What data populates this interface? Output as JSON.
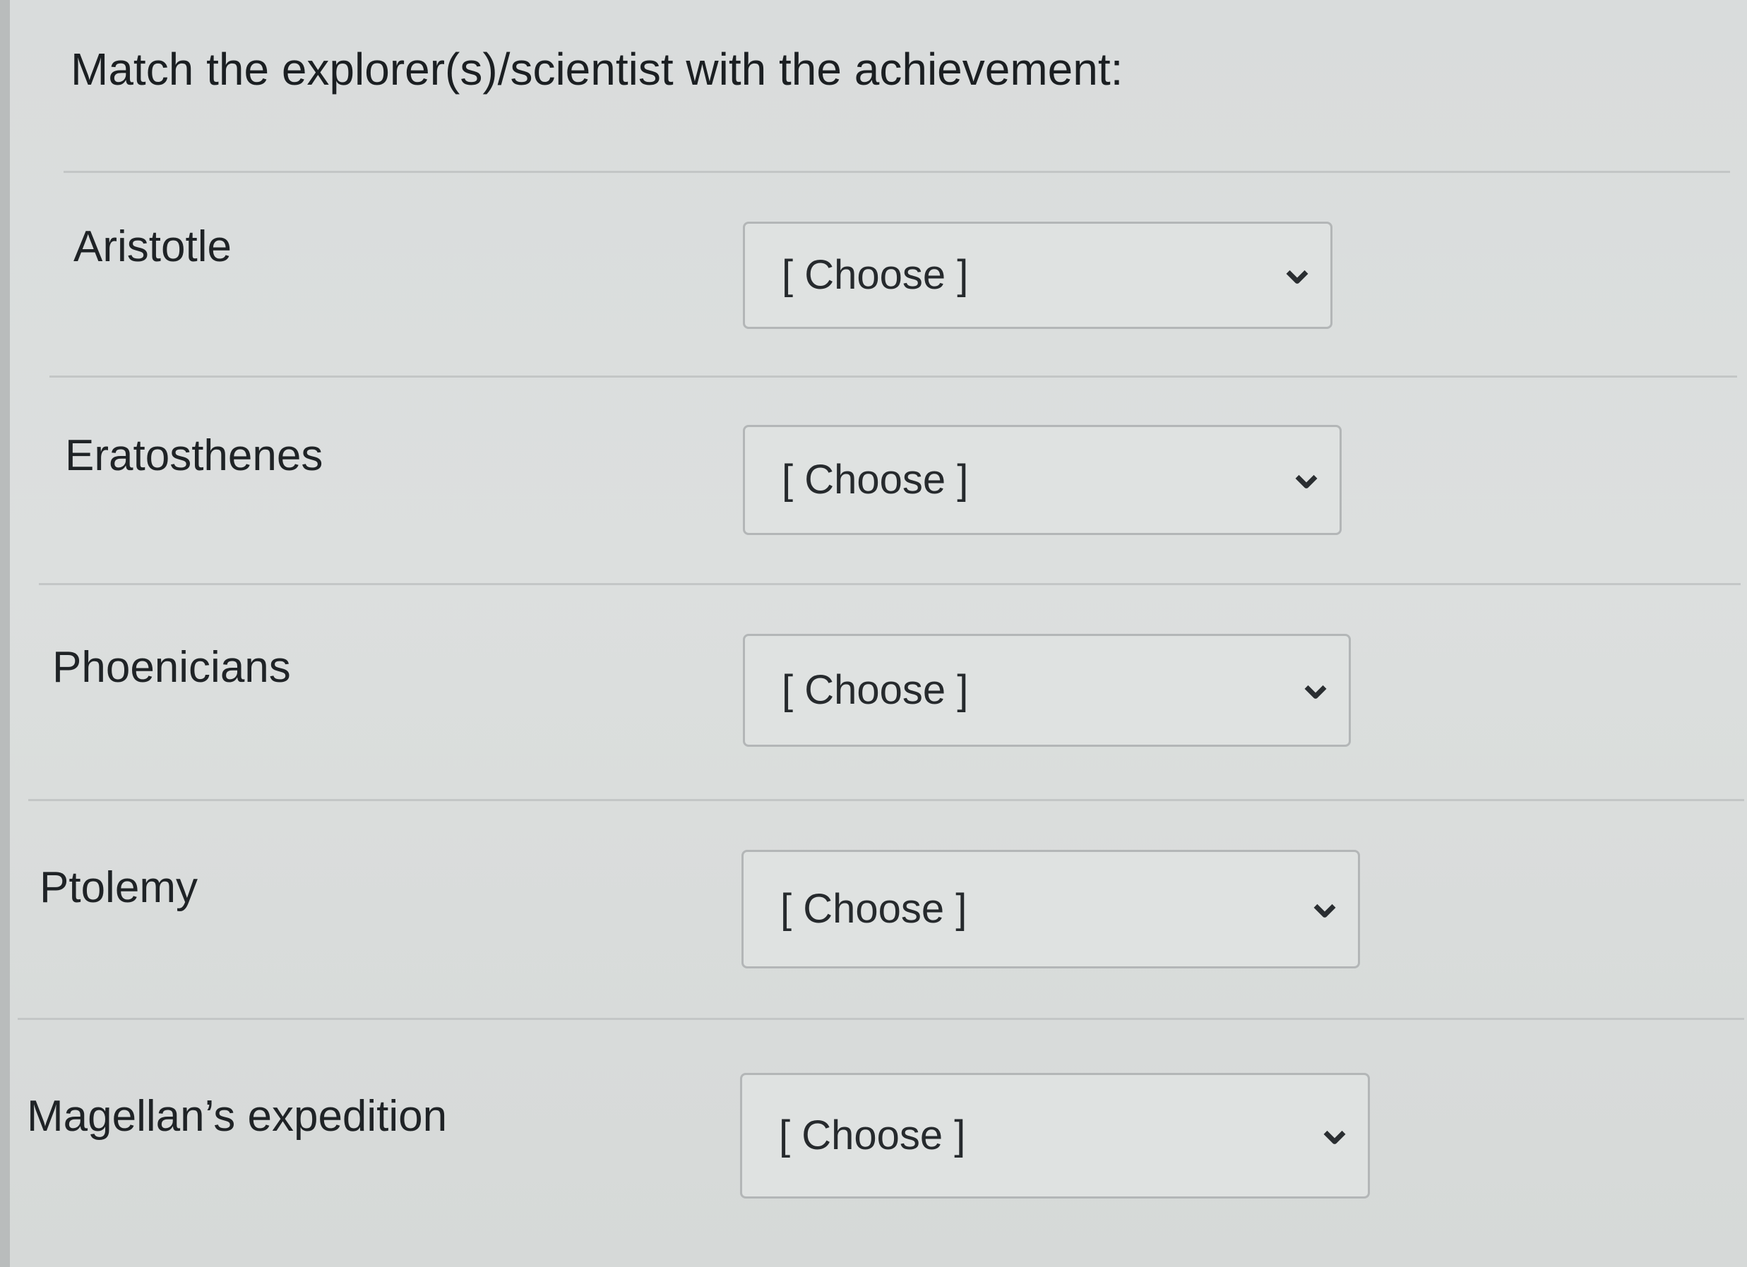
{
  "question": {
    "prompt": "Match the explorer(s)/scientist with the achievement:"
  },
  "rows": [
    {
      "term": "Aristotle",
      "selected": "[ Choose ]"
    },
    {
      "term": "Eratosthenes",
      "selected": "[ Choose ]"
    },
    {
      "term": "Phoenicians",
      "selected": "[ Choose ]"
    },
    {
      "term": "Ptolemy",
      "selected": "[ Choose ]"
    },
    {
      "term": "Magellan’s expedition",
      "selected": "[ Choose ]"
    }
  ],
  "icons": {
    "dropdown": "chevron-down-icon"
  }
}
